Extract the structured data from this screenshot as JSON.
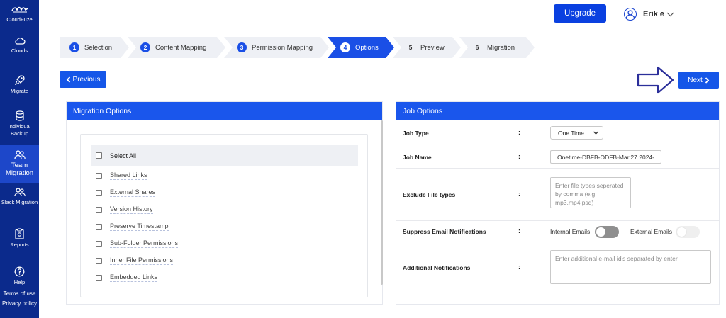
{
  "sidebar": {
    "brand": "CloudFuze",
    "items": [
      {
        "label": "Clouds",
        "icon": "cloud-icon"
      },
      {
        "label": "Migrate",
        "icon": "rocket-icon"
      },
      {
        "label": "Individual Backup",
        "icon": "database-icon"
      },
      {
        "label": "Team Migration",
        "icon": "users-icon",
        "active": true
      },
      {
        "label": "Slack Migration",
        "icon": "users-icon"
      },
      {
        "label": "Reports",
        "icon": "clipboard-icon"
      },
      {
        "label": "Help",
        "icon": "question-icon"
      }
    ],
    "links": [
      "Terms of use",
      "Privacy policy"
    ]
  },
  "header": {
    "upgrade_label": "Upgrade",
    "user_name": "Erik e"
  },
  "steps": [
    {
      "num": "1",
      "label": "Selection",
      "state": "done"
    },
    {
      "num": "2",
      "label": "Content Mapping",
      "state": "done"
    },
    {
      "num": "3",
      "label": "Permission Mapping",
      "state": "done"
    },
    {
      "num": "4",
      "label": "Options",
      "state": "active"
    },
    {
      "num": "5",
      "label": "Preview",
      "state": "future"
    },
    {
      "num": "6",
      "label": "Migration",
      "state": "future"
    }
  ],
  "nav": {
    "previous_label": "Previous",
    "next_label": "Next"
  },
  "migration_options": {
    "title": "Migration Options",
    "select_all": "Select All",
    "options": [
      "Shared Links",
      "External Shares",
      "Version History",
      "Preserve Timestamp",
      "Sub-Folder Permissions",
      "Inner File Permissions",
      "Embedded Links"
    ]
  },
  "job_options": {
    "title": "Job Options",
    "colon": ":",
    "job_type_label": "Job Type",
    "job_type_value": "One Time",
    "job_name_label": "Job Name",
    "job_name_value": "Onetime-DBFB-ODFB-Mar.27.2024-",
    "exclude_label": "Exclude File types",
    "exclude_placeholder": "Enter file types seperated by comma (e.g. mp3,mp4,psd)",
    "suppress_label": "Suppress Email Notifications",
    "internal_emails_label": "Internal Emails",
    "external_emails_label": "External Emails",
    "internal_emails_on": false,
    "external_emails_on": false,
    "additional_label": "Additional Notifications",
    "additional_placeholder": "Enter additional e-mail id's separated by enter"
  },
  "colors": {
    "sidebar_bg": "#0b2a8c",
    "sidebar_active": "#1d47c9",
    "primary": "#1a56ec"
  }
}
